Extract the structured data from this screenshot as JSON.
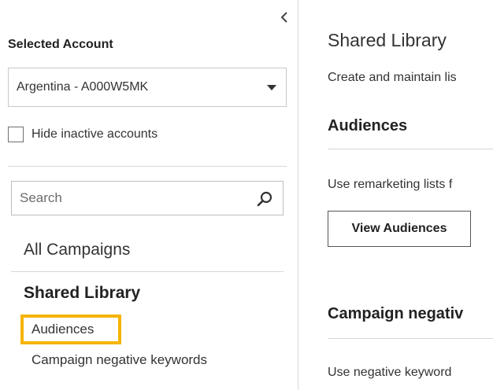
{
  "sidebar": {
    "collapse_icon": "chevron-left-icon",
    "account_section_title": "Selected Account",
    "account_select_value": "Argentina - A000W5MK",
    "hide_inactive_label": "Hide inactive accounts",
    "hide_inactive_checked": false,
    "search_placeholder": "Search",
    "search_icon": "search-icon",
    "all_campaigns": "All Campaigns",
    "shared_library_heading": "Shared Library",
    "items": [
      {
        "label": "Audiences",
        "selected": true
      },
      {
        "label": "Campaign negative keywords",
        "selected": false
      }
    ],
    "highlight_color": "#f5b400"
  },
  "main": {
    "title": "Shared Library",
    "description": "Create and maintain lis",
    "audiences": {
      "heading": "Audiences",
      "text": "Use remarketing lists f",
      "button_label": "View Audiences"
    },
    "negative": {
      "heading": "Campaign negativ",
      "text": "Use negative keyword"
    }
  }
}
